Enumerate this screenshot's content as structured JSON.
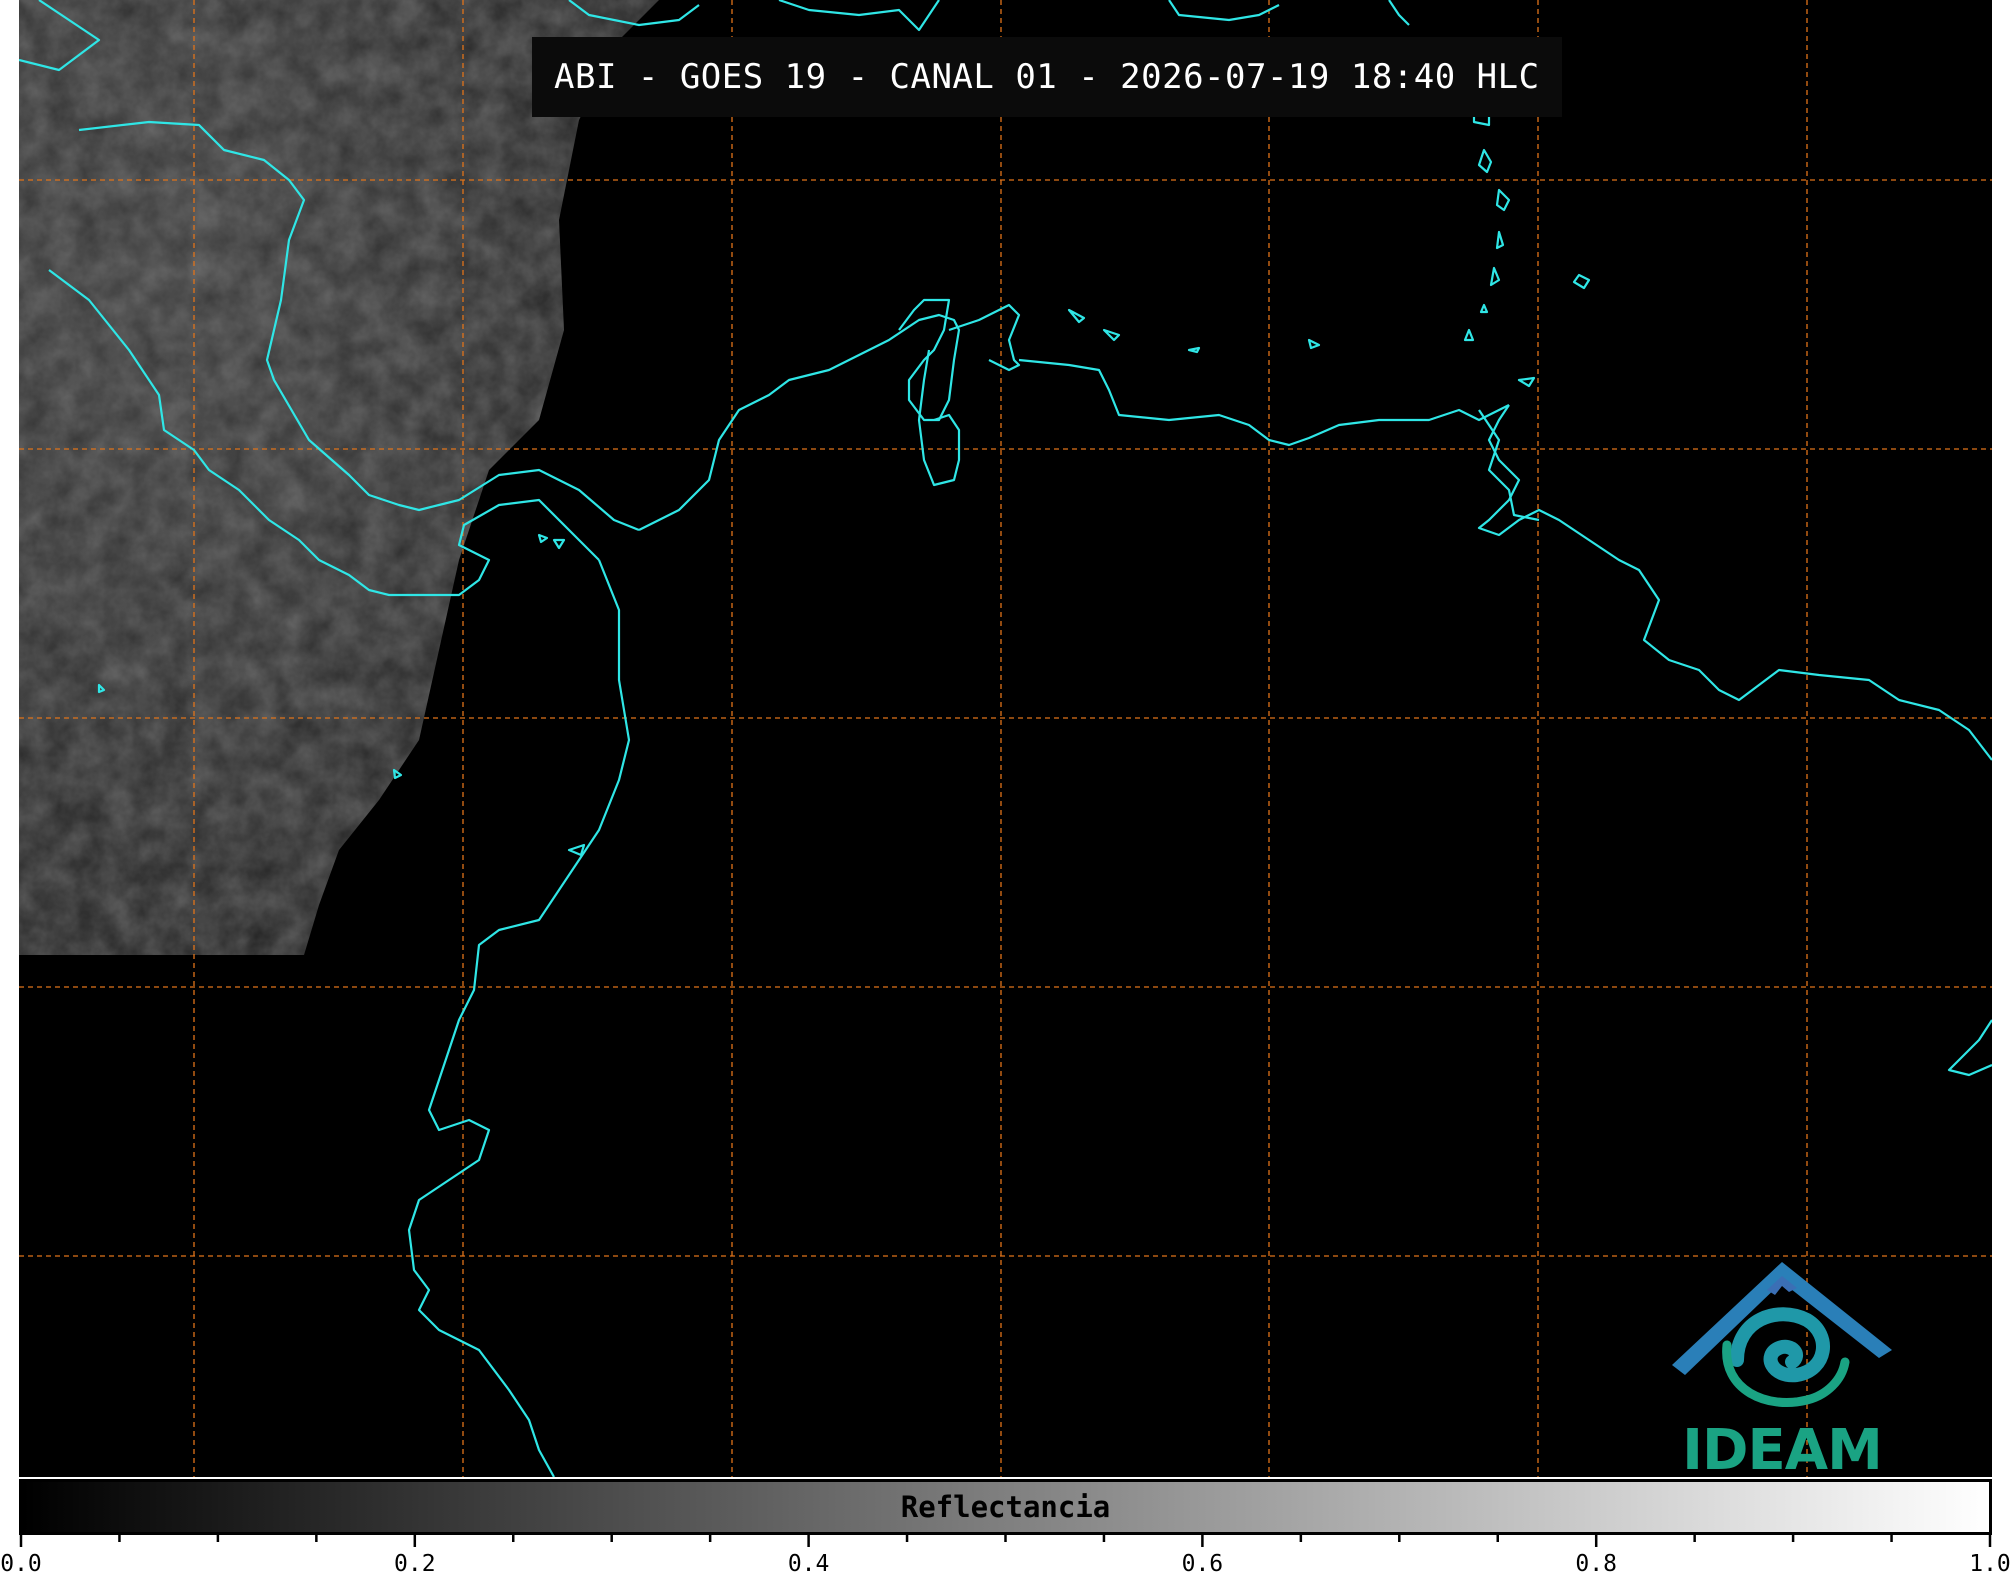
{
  "title": "ABI - GOES 19 - CANAL 01 - 2026-07-19 18:40 HLC",
  "colorbar": {
    "label": "Reflectancia",
    "range": [
      0.0,
      1.0
    ],
    "ticks": [
      "0.0",
      "0.2",
      "0.4",
      "0.6",
      "0.8",
      "1.0"
    ],
    "colormap": "grayscale black to white"
  },
  "logo": {
    "text": "IDEAM"
  },
  "colors": {
    "coastline": "#2fe6e6",
    "gridlines": "#e0731a",
    "background": "#000000",
    "cloud_region": "#2b2b2b",
    "logo_blue": "#2a7fb8",
    "logo_green": "#1aa383"
  },
  "map": {
    "gridlines": "dashed",
    "coastlines": true,
    "labels": []
  }
}
